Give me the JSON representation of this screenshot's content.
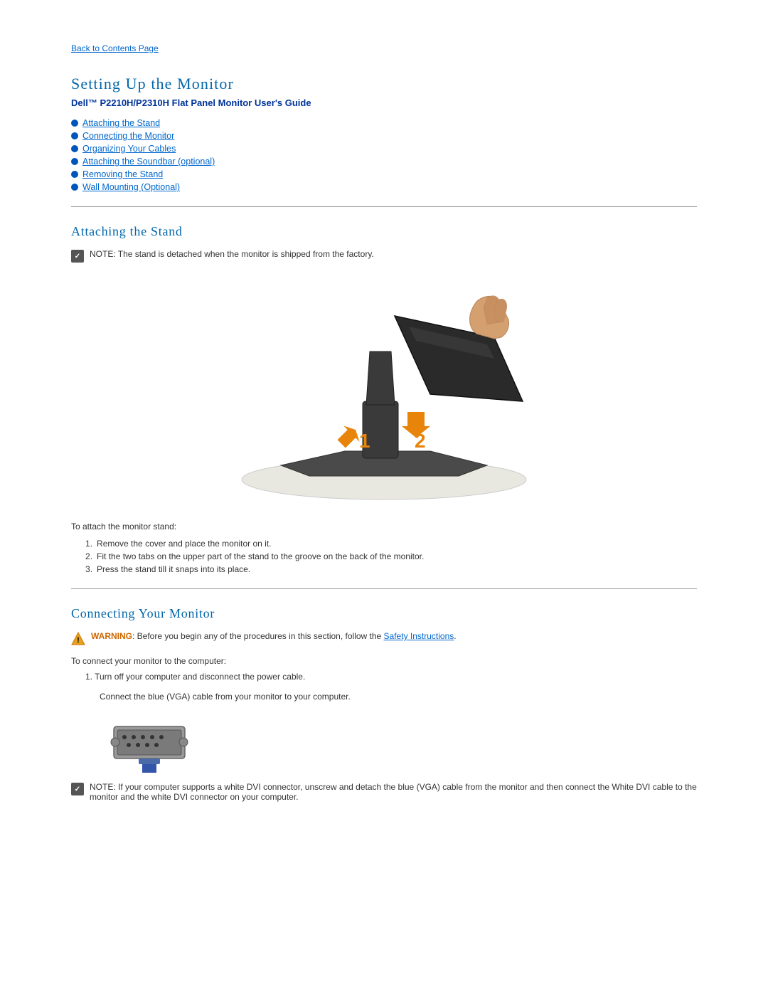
{
  "back_link": "Back to Contents Page",
  "page_title": "Setting Up the Monitor",
  "subtitle": "Dell™ P2210H/P2310H Flat Panel Monitor User's Guide",
  "nav_items": [
    "Attaching the Stand",
    "Connecting the Monitor",
    "Organizing Your Cables",
    "Attaching the Soundbar (optional)",
    "Removing the Stand",
    "Wall Mounting (Optional)"
  ],
  "attaching_title": "Attaching the Stand",
  "note_text": "NOTE: The stand is detached when the monitor is shipped from the factory.",
  "stand_instruction_label": "To attach the monitor stand:",
  "stand_steps": [
    "Remove the cover and place the monitor on it.",
    "Fit the two tabs on the upper part of the stand to the groove on the back of the monitor.",
    "Press the stand till it snaps into its place."
  ],
  "connecting_title": "Connecting Your Monitor",
  "warning_label": "WARNING",
  "warning_text": ": Before you begin any of the procedures in this section, follow the ",
  "safety_link": "Safety Instructions",
  "warning_period": ".",
  "connect_label": "To connect your monitor to the computer:",
  "connect_step1": "1.   Turn off your computer and disconnect the power cable.",
  "connect_vga_label": "Connect the blue (VGA) cable from your monitor to your computer.",
  "note2_text": "NOTE:  If your computer supports a white DVI connector, unscrew and detach the blue (VGA) cable from the monitor and then connect the White DVI cable to the monitor and the white DVI connector on your computer."
}
